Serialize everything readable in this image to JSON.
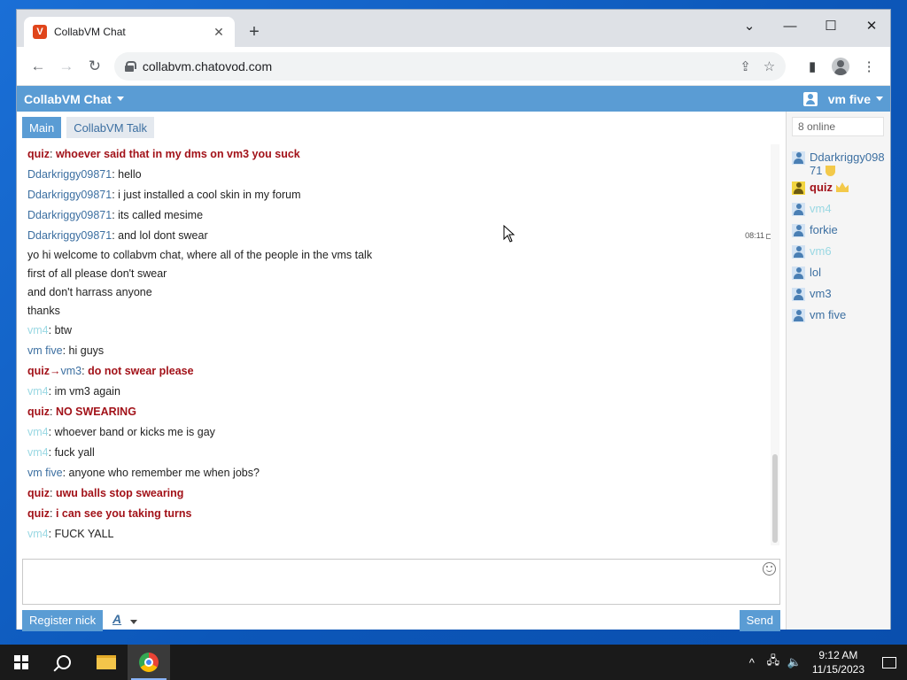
{
  "browser": {
    "tab_title": "CollabVM Chat",
    "favicon_glyph": "V",
    "url": "collabvm.chatovod.com",
    "close_glyph": "✕",
    "newtab_glyph": "+",
    "back_glyph": "←",
    "forward_glyph": "→",
    "reload_glyph": "↻",
    "share_glyph": "⇪",
    "star_glyph": "☆",
    "sidebar_glyph": "▮",
    "menu_glyph": "⋮",
    "min_glyph": "—",
    "max_glyph": "☐",
    "winclose_glyph": "✕",
    "tabsearch_glyph": "⌄"
  },
  "app": {
    "title": "CollabVM Chat",
    "username": "vm five",
    "accent_color": "#5a9cd4",
    "admin_color": "#a21219"
  },
  "tabs": [
    {
      "label": "Main"
    },
    {
      "label": "CollabVM Talk"
    }
  ],
  "messages": [
    {
      "nick": "quiz",
      "text": "whoever said that in my dms on vm3 you suck"
    },
    {
      "nick": "Ddarkriggy09871",
      "text": "hello"
    },
    {
      "nick": "Ddarkriggy09871",
      "text": "i just installed a cool skin in my forum"
    },
    {
      "nick": "Ddarkriggy09871",
      "text": "its called mesime"
    },
    {
      "nick": "Ddarkriggy09871",
      "text": "and lol dont swear",
      "time": "08:11"
    },
    {
      "text": "yo hi welcome to collabvm chat, where all of the people in the vms talk"
    },
    {
      "text": "first of all please don't swear"
    },
    {
      "text": "and don't harrass anyone"
    },
    {
      "text": "thanks"
    },
    {
      "nick": "vm4",
      "text": "btw"
    },
    {
      "nick": "vm five",
      "text": "hi guys"
    },
    {
      "nick": "quiz",
      "arrow": "→",
      "target": "vm3",
      "text": "do not swear please"
    },
    {
      "nick": "vm4",
      "text": "im vm3 again"
    },
    {
      "nick": "quiz",
      "text": "NO SWEARING"
    },
    {
      "nick": "vm4",
      "text": "whoever band or kicks me is gay"
    },
    {
      "nick": "vm4",
      "text": "fuck yall"
    },
    {
      "nick": "vm five",
      "text": "anyone who remember me when jobs?"
    },
    {
      "nick": "quiz",
      "text": "uwu balls stop swearing"
    },
    {
      "nick": "quiz",
      "text": "i can see you taking turns"
    },
    {
      "nick": "vm4",
      "text": "FUCK YALL"
    }
  ],
  "composer": {
    "placeholder": "",
    "register_label": "Register nick",
    "font_label": "A",
    "send_label": "Send"
  },
  "sidebar": {
    "online_count": "8 online",
    "users": [
      {
        "name": "Ddarkriggy09871",
        "icon": "user-icon",
        "badge": "shield-icon"
      },
      {
        "name": "quiz",
        "icon": "admin-user-icon",
        "badge": "crown-icon"
      },
      {
        "name": "vm4",
        "icon": "user-icon"
      },
      {
        "name": "forkie",
        "icon": "user-icon"
      },
      {
        "name": "vm6",
        "icon": "user-icon"
      },
      {
        "name": "lol",
        "icon": "user-icon"
      },
      {
        "name": "vm3",
        "icon": "user-icon"
      },
      {
        "name": "vm five",
        "icon": "user-icon"
      }
    ]
  },
  "taskbar": {
    "time": "9:12 AM",
    "date": "11/15/2023",
    "tray_chevron": "^",
    "network_glyph": "🖧",
    "volume_glyph": "🔈"
  }
}
